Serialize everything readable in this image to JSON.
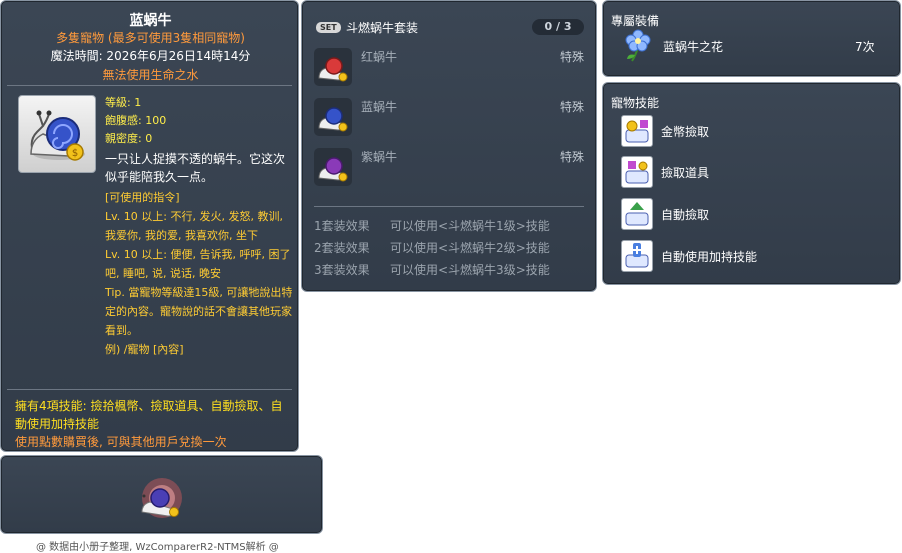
{
  "item_code": "05002265",
  "main": {
    "title": "蓝蜗牛",
    "subtitle": "多隻寵物 (最多可使用3隻相同寵物)",
    "magic_time": "魔法時間: 2026年6月26日14時14分",
    "warning": "無法使用生命之水",
    "stats": [
      "等級: 1",
      "飽腹感: 100",
      "親密度: 0"
    ],
    "description": "一只让人捉摸不透的蜗牛。它这次似乎能陪我久一点。",
    "commands": "[可使用的指令]\nLv. 10 以上: 不行, 发火, 发怒, 教训, 我爱你, 我的爱, 我喜欢你, 坐下\nLv. 10 以上: 便便, 告诉我, 呼呼, 困了吧, 睡吧, 说, 说话, 晚安\nTip. 當寵物等級達15級, 可讓牠說出特定的內容。寵物說的話不會讓其他玩家看到。\n例) /寵物 [內容]",
    "skills": "擁有4項技能: 撿拾楓幣、撿取道具、自動撿取、自動使用加持技能",
    "exchange": "使用點數購買後, 可與其他用戶兌換一次"
  },
  "footer": "@ 数据由小册子整理, WzComparerR2-NTMS解析 @",
  "set": {
    "badge": "SET",
    "title": "斗燃蜗牛套装",
    "count": "0 / 3",
    "items": [
      {
        "name": "红蜗牛",
        "type": "特殊",
        "shell_color": "#d93a3a"
      },
      {
        "name": "蓝蜗牛",
        "type": "特殊",
        "shell_color": "#3553c9"
      },
      {
        "name": "紫蜗牛",
        "type": "特殊",
        "shell_color": "#8a3ab8"
      }
    ],
    "effects": [
      {
        "label": "1套装效果",
        "text": "可以使用<斗燃蜗牛1级>技能"
      },
      {
        "label": "2套装效果",
        "text": "可以使用<斗燃蜗牛2级>技能"
      },
      {
        "label": "3套装效果",
        "text": "可以使用<斗燃蜗牛3级>技能"
      }
    ]
  },
  "equip": {
    "title": "專屬裝備",
    "name": "蓝蜗牛之花",
    "count": "7次"
  },
  "pet_skills": {
    "title": "寵物技能",
    "items": [
      "金幣撿取",
      "撿取道具",
      "自動撿取",
      "自動使用加持技能"
    ]
  }
}
